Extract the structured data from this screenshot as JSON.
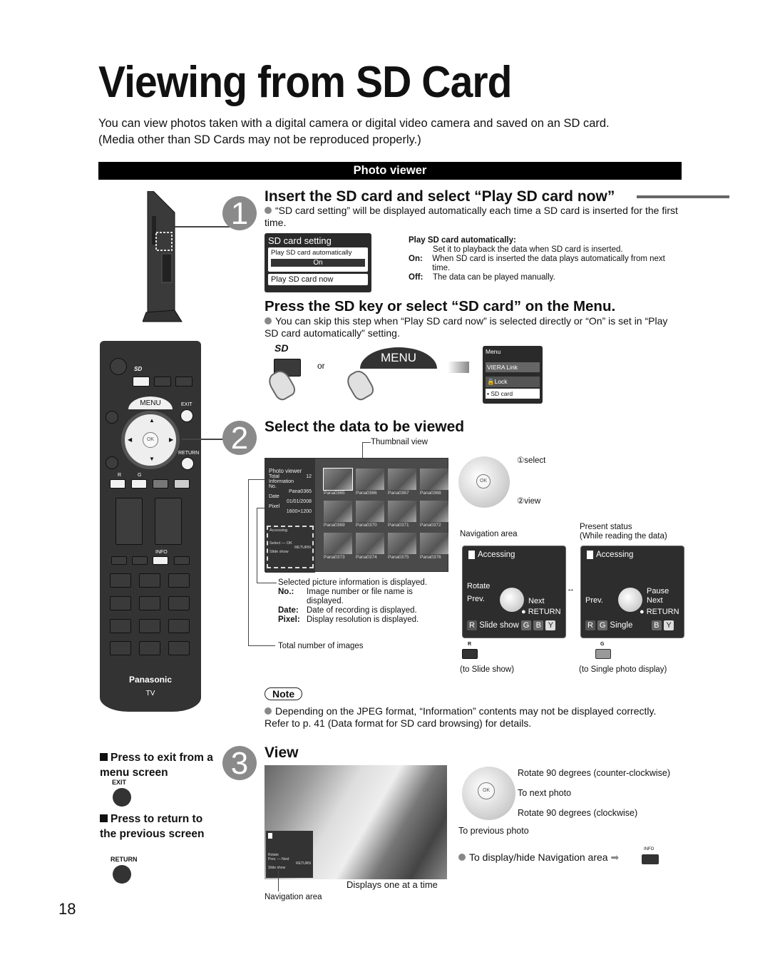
{
  "page": {
    "title": "Viewing from SD Card",
    "intro_line1": "You can view photos taken with a digital camera or digital video camera and saved on an SD card.",
    "intro_line2": "(Media other than SD Cards may not be reproduced properly.)",
    "section_label": "Photo viewer",
    "page_number": "18"
  },
  "step1": {
    "number": "1",
    "heading": "Insert the SD card and select “Play SD card now”",
    "bullet": "“SD card setting” will be displayed automatically each time a SD card is inserted for the first time.",
    "osd": {
      "title": "SD card setting",
      "row1": "Play SD card automatically",
      "row1_value": "On",
      "row2": "Play SD card now"
    },
    "explain": {
      "heading": "Play SD card automatically:",
      "desc": "Set it to playback the data when SD card is inserted.",
      "on_label": "On:",
      "on_text": "When SD card is inserted the data plays automatically from next time.",
      "off_label": "Off:",
      "off_text": "The data can be played manually."
    }
  },
  "step_sd": {
    "heading": "Press the SD key or select “SD card” on the Menu.",
    "bullet": "You can skip this step when “Play SD card now” is selected directly or “On” is set in “Play SD card automatically” setting.",
    "or_label": "or",
    "menu_key": "MENU",
    "menu_osd": {
      "title": "Menu",
      "item1": "VIERA Link",
      "item2": "Lock",
      "item3": "SD card"
    }
  },
  "step2": {
    "number": "2",
    "heading": "Select the data to be viewed",
    "thumbnail_view_label": "Thumbnail view",
    "viewer": {
      "title": "Photo viewer",
      "total_label": "Total",
      "total_value": "12",
      "info_label": "Information",
      "no_label": "No.",
      "no_value": "Pana0365",
      "date_label": "Date",
      "date_value": "01/01/2008",
      "pixel_label": "Pixel",
      "pixel_value": "1600×1200",
      "accessing": "Accessing",
      "select_label": "Select",
      "ok_label": "OK",
      "return_label": "RETURN",
      "slideshow_label": "Slide show",
      "thumbnails": [
        "Pana0365",
        "Pana0366",
        "Pana0367",
        "Pana0368",
        "Pana0369",
        "Pana0370",
        "Pana0371",
        "Pana0372",
        "Pana0373",
        "Pana0374",
        "Pana0375",
        "Pana0376"
      ]
    },
    "dial_select": "①select",
    "dial_view": "②view",
    "info_desc": "Selected picture information is displayed.",
    "no_label": "No.:",
    "no_desc": "Image number or file name is displayed.",
    "date_label": "Date:",
    "date_desc": "Date of recording is displayed.",
    "pixel_label": "Pixel:",
    "pixel_desc": "Display resolution is displayed.",
    "total_desc": "Total number of images",
    "navigation_area_label": "Navigation area",
    "present_status_label": "Present status",
    "present_status_sub": "(While reading the data)",
    "nav_left": {
      "accessing": "Accessing",
      "rotate": "Rotate",
      "prev": "Prev.",
      "next": "Next",
      "return": "RETURN",
      "keys": [
        "R",
        "G",
        "B",
        "Y"
      ],
      "mode_label": "Slide show"
    },
    "nav_right": {
      "accessing": "Accessing",
      "pause": "Pause",
      "prev": "Prev.",
      "next": "Next",
      "return": "RETURN",
      "keys": [
        "R",
        "G",
        "B",
        "Y"
      ],
      "mode_label": "Single"
    },
    "r_key_label": "R",
    "g_key_label": "G",
    "to_slideshow": "(to Slide show)",
    "to_single": "(to Single photo display)"
  },
  "note": {
    "label": "Note",
    "text": "Depending on the JPEG format, “Information” contents may not be displayed correctly. Refer to p. 41 (Data format for SD card browsing) for details."
  },
  "side_notes": {
    "exit_text": "Press to exit from a menu screen",
    "exit_key": "EXIT",
    "return_text": "Press to return to the previous screen",
    "return_key": "RETURN"
  },
  "step3": {
    "number": "3",
    "heading": "View",
    "displays_one": "Displays one at a time",
    "navigation_area": "Navigation area",
    "up_desc": "Rotate 90 degrees (counter-clockwise)",
    "right_desc": "To next photo",
    "down_desc": "Rotate 90 degrees (clockwise)",
    "left_desc": "To previous photo",
    "info_bullet": "To display/hide Navigation area",
    "info_key": "INFO",
    "ok_label": "OK",
    "mini_nav": {
      "rotate": "Rotate",
      "prev": "Prev.",
      "next": "Next",
      "return": "RETURN",
      "slideshow": "Slide show"
    }
  },
  "remote": {
    "menu_label": "MENU",
    "exit_label": "EXIT",
    "return_label": "RETURN",
    "ok_label": "OK",
    "r_label": "R",
    "g_label": "G",
    "info_label": "INFO",
    "brand": "Panasonic",
    "model": "TV"
  }
}
